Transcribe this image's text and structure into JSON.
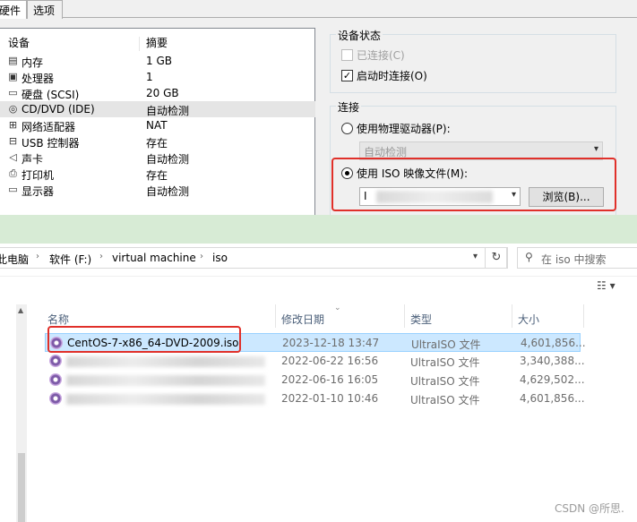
{
  "dialog": {
    "tabs": [
      {
        "label": "硬件",
        "active": true
      },
      {
        "label": "选项",
        "active": false
      }
    ],
    "list": {
      "col_device": "设备",
      "col_summary": "摘要",
      "rows": [
        {
          "icon": "memory-icon",
          "glyph": "▤",
          "name": "内存",
          "summary": "1 GB"
        },
        {
          "icon": "processor-icon",
          "glyph": "▣",
          "name": "处理器",
          "summary": "1"
        },
        {
          "icon": "harddisk-icon",
          "glyph": "▭",
          "name": "硬盘 (SCSI)",
          "summary": "20 GB"
        },
        {
          "icon": "cdrom-icon",
          "glyph": "◎",
          "name": "CD/DVD (IDE)",
          "summary": "自动检测"
        },
        {
          "icon": "network-adapter-icon",
          "glyph": "⊞",
          "name": "网络适配器",
          "summary": "NAT"
        },
        {
          "icon": "usb-icon",
          "glyph": "⊟",
          "name": "USB 控制器",
          "summary": "存在"
        },
        {
          "icon": "sound-card-icon",
          "glyph": "◁",
          "name": "声卡",
          "summary": "自动检测"
        },
        {
          "icon": "printer-icon",
          "glyph": "⎙",
          "name": "打印机",
          "summary": "存在"
        },
        {
          "icon": "display-icon",
          "glyph": "▭",
          "name": "显示器",
          "summary": "自动检测"
        }
      ]
    },
    "status": {
      "title": "设备状态",
      "connected": {
        "label": "已连接(C)",
        "checked": false,
        "disabled": true
      },
      "connect_on_power": {
        "label": "启动时连接(O)",
        "checked": true,
        "disabled": false
      }
    },
    "connection": {
      "title": "连接",
      "physical": {
        "label": "使用物理驱动器(P):",
        "selected": false
      },
      "physical_value": "自动检测",
      "iso": {
        "label": "使用 ISO 映像文件(M):",
        "selected": true
      },
      "iso_value": "I",
      "browse_label": "浏览(B)..."
    }
  },
  "explorer": {
    "breadcrumb": [
      "此电脑",
      "软件 (F:)",
      "virtual machine",
      "iso"
    ],
    "search_placeholder": "在 iso 中搜索",
    "columns": {
      "name": "名称",
      "date": "修改日期",
      "type": "类型",
      "size": "大小"
    },
    "files": [
      {
        "name": "CentOS-7-x86_64-DVD-2009.iso",
        "date": "2023-12-18 13:47",
        "type": "UltraISO 文件",
        "size": "4,601,856...",
        "selected": true
      },
      {
        "name": "",
        "date": "2022-06-22 16:56",
        "type": "UltraISO 文件",
        "size": "3,340,388..."
      },
      {
        "name": "",
        "date": "2022-06-16 16:05",
        "type": "UltraISO 文件",
        "size": "4,629,502..."
      },
      {
        "name": "",
        "date": "2022-01-10 10:46",
        "type": "UltraISO 文件",
        "size": "4,601,856..."
      }
    ]
  },
  "watermark": "CSDN @所思.",
  "colors": {
    "highlight_red": "#e0302a",
    "selection_blue": "#cce8ff",
    "band_green": "#d7ebd5"
  }
}
